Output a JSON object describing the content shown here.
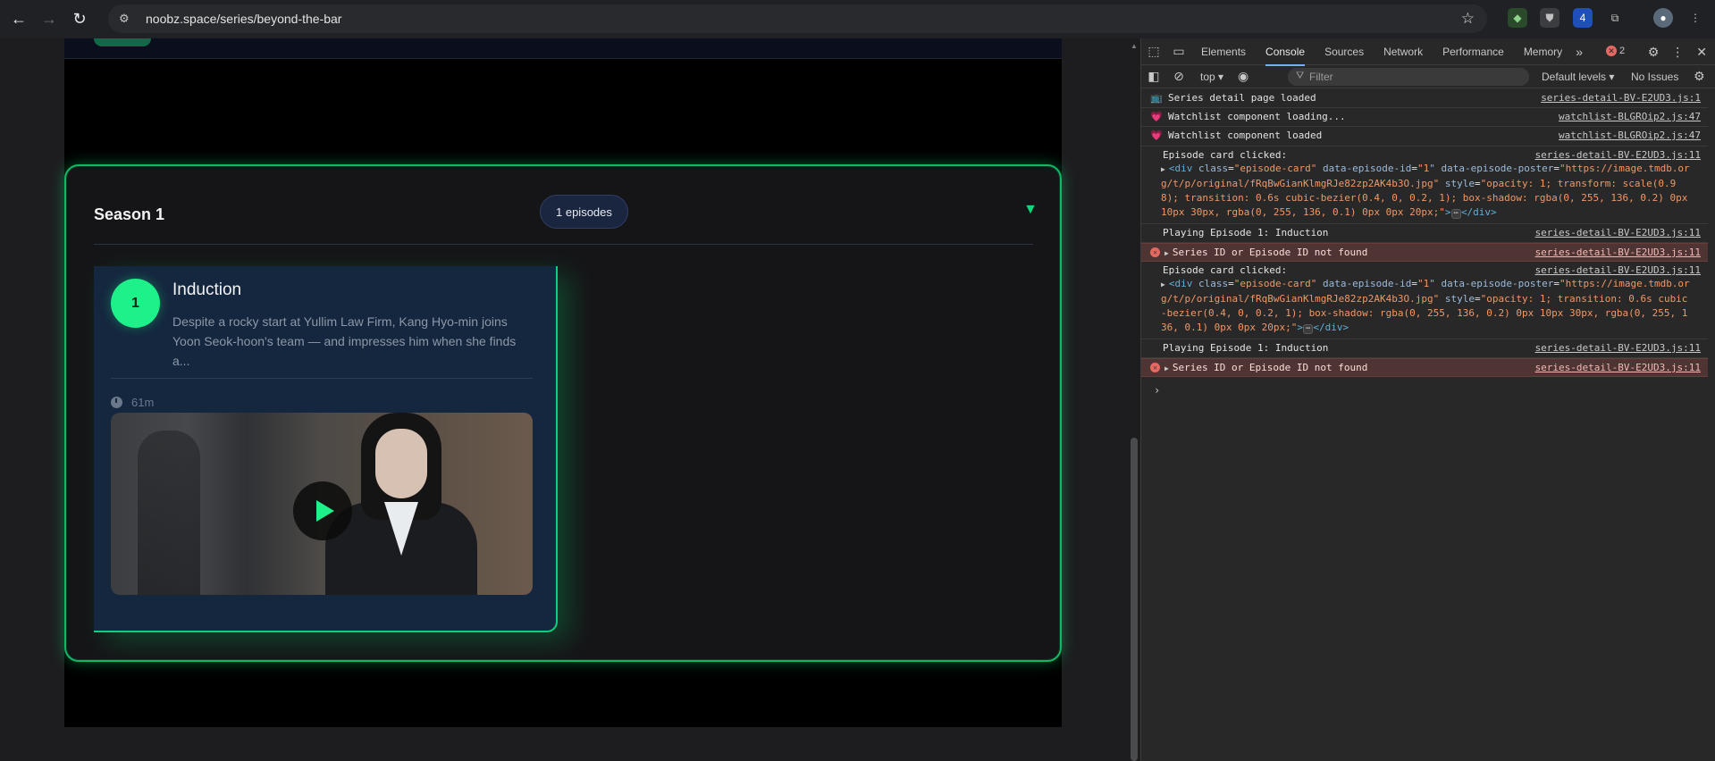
{
  "browser": {
    "url": "noobz.space/series/beyond-the-bar",
    "back_icon": "arrow-left",
    "forward_icon": "arrow-right",
    "reload_icon": "reload",
    "star_icon": "star",
    "extensions_badge": "4"
  },
  "season": {
    "title": "Season 1",
    "episodes_badge": "1 episodes",
    "chevron_icon": "chevron-down"
  },
  "episode": {
    "number": "1",
    "title": "Induction",
    "description": "Despite a rocky start at Yullim Law Firm, Kang Hyo-min joins Yoon Seok-hoon's team — and impresses him when she finds a...",
    "duration": "61m"
  },
  "devtools": {
    "tabs": [
      "Elements",
      "Console",
      "Sources",
      "Network",
      "Performance",
      "Memory"
    ],
    "active_tab": "Console",
    "error_count": "2",
    "context": "top ▾",
    "filter_placeholder": "Filter",
    "levels": "Default levels ▾",
    "issues": "No Issues",
    "logs": [
      {
        "icon": "📺",
        "message": "Series detail page loaded",
        "source": "series-detail-BV-E2UD3.js:1"
      },
      {
        "icon": "💗",
        "message": "Watchlist component loading...",
        "source": "watchlist-BLGROip2.js:47"
      },
      {
        "icon": "💗",
        "message": "Watchlist component loaded",
        "source": "watchlist-BLGROip2.js:47"
      },
      {
        "message": "Episode card clicked:",
        "source": "series-detail-BV-E2UD3.js:11"
      },
      {
        "message": "Playing Episode 1: Induction",
        "source": "series-detail-BV-E2UD3.js:11"
      },
      {
        "message": "Series ID or Episode ID not found",
        "source": "series-detail-BV-E2UD3.js:11"
      },
      {
        "message": "Episode card clicked:",
        "source": "series-detail-BV-E2UD3.js:11"
      },
      {
        "message": "Playing Episode 1: Induction",
        "source": "series-detail-BV-E2UD3.js:11"
      },
      {
        "message": "Series ID or Episode ID not found",
        "source": "series-detail-BV-E2UD3.js:11"
      }
    ],
    "code1": {
      "open": "<div",
      "a1": "class",
      "v1": "\"episode-card\"",
      "a2": "data-episode-id",
      "v2": "\"1\"",
      "a3": "data-episode-poster",
      "v3": "\"https://image.tmdb.org/t/p/original/fRqBwGianKlmgRJe82zp2AK4b3O.jpg\"",
      "a4": "style",
      "v4": "\"opacity: 1; transform: scale(0.98); transition: 0.6s cubic-bezier(0.4, 0, 0.2, 1); box-shadow: rgba(0, 255, 136, 0.2) 0px 10px 30px, rgba(0, 255, 136, 0.1) 0px 0px 20px;\"",
      "close": ">",
      "ellipsis": "⋯",
      "end": "</div>"
    },
    "code2": {
      "open": "<div",
      "a1": "class",
      "v1": "\"episode-card\"",
      "a2": "data-episode-id",
      "v2": "\"1\"",
      "a3": "data-episode-poster",
      "v3": "\"https://image.tmdb.org/t/p/original/fRqBwGianKlmgRJe82zp2AK4b3O.jpg\"",
      "a4": "style",
      "v4": "\"opacity: 1; transition: 0.6s cubic-bezier(0.4, 0, 0.2, 1); box-shadow: rgba(0, 255, 136, 0.2) 0px 10px 30px, rgba(0, 255, 136, 0.1) 0px 0px 20px;\"",
      "close": ">",
      "ellipsis": "⋯",
      "end": "</div>"
    },
    "prompt": "›"
  }
}
